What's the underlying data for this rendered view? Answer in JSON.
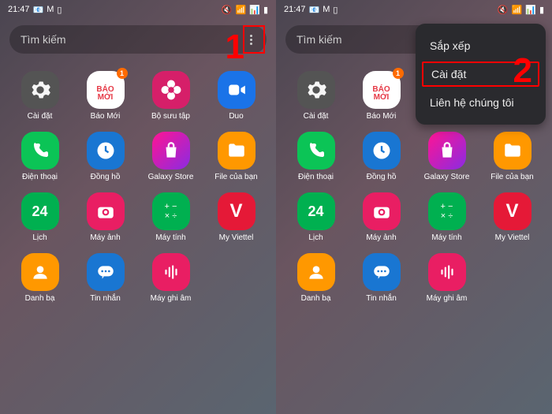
{
  "status": {
    "time": "21:47",
    "icons_left": [
      "📧",
      "M",
      "📋"
    ],
    "icons_right": [
      "🔇",
      "📶",
      "📊",
      "🔋"
    ]
  },
  "search": {
    "placeholder": "Tìm kiếm"
  },
  "apps": [
    {
      "name": "Cài đặt",
      "icon": "gear",
      "badge": null
    },
    {
      "name": "Báo Mới",
      "icon": "baomoi",
      "badge": "1"
    },
    {
      "name": "Bộ sưu tập",
      "icon": "flower",
      "badge": null
    },
    {
      "name": "Duo",
      "icon": "duo",
      "badge": null
    },
    {
      "name": "Điện thoại",
      "icon": "phone",
      "badge": null
    },
    {
      "name": "Đồng hồ",
      "icon": "clock",
      "badge": null
    },
    {
      "name": "Galaxy Store",
      "icon": "store",
      "badge": null
    },
    {
      "name": "File của bạn",
      "icon": "files",
      "badge": null
    },
    {
      "name": "Lịch",
      "icon": "cal",
      "badge": null
    },
    {
      "name": "Máy ảnh",
      "icon": "camera",
      "badge": null
    },
    {
      "name": "Máy tính",
      "icon": "calc",
      "badge": null
    },
    {
      "name": "My Viettel",
      "icon": "viettel",
      "badge": null
    },
    {
      "name": "Danh bạ",
      "icon": "contacts",
      "badge": null
    },
    {
      "name": "Tin nhắn",
      "icon": "msg",
      "badge": null
    },
    {
      "name": "Máy ghi âm",
      "icon": "voice",
      "badge": null
    }
  ],
  "menu": {
    "items": [
      "Sắp xếp",
      "Cài đặt",
      "Liên hệ chúng tôi"
    ],
    "highlight_index": 1
  },
  "annotations": {
    "left": "1",
    "right": "2"
  },
  "calendar_day": "24",
  "baomoi_text": "BÁO\nMỚI",
  "viettel_text": "V"
}
